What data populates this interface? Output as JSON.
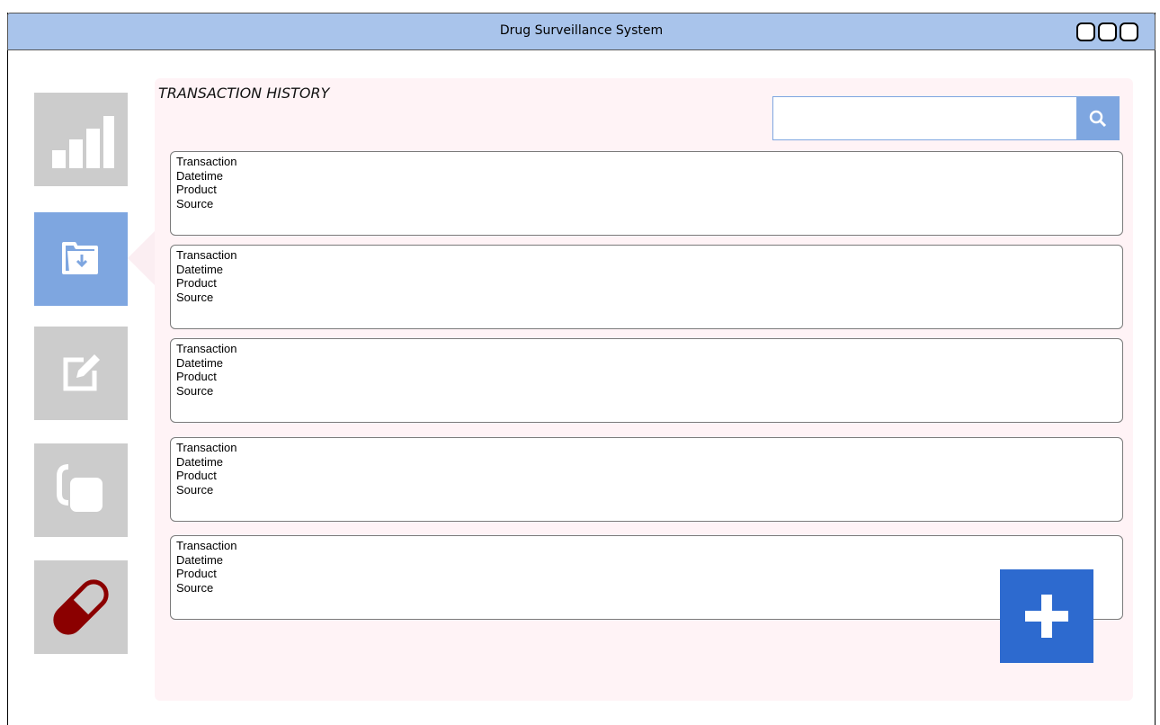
{
  "window": {
    "title": "Drug Surveillance System"
  },
  "panel": {
    "title": "TRANSACTION HISTORY"
  },
  "search": {
    "placeholder": "",
    "value": ""
  },
  "transactions": [
    {
      "transaction": "Transaction",
      "datetime": "Datetime",
      "product": "Product",
      "source": "Source"
    },
    {
      "transaction": "Transaction",
      "datetime": "Datetime",
      "product": "Product",
      "source": "Source"
    },
    {
      "transaction": "Transaction",
      "datetime": "Datetime",
      "product": "Product",
      "source": "Source"
    },
    {
      "transaction": "Transaction",
      "datetime": "Datetime",
      "product": "Product",
      "source": "Source"
    },
    {
      "transaction": "Transaction",
      "datetime": "Datetime",
      "product": "Product",
      "source": "Source"
    }
  ],
  "sidebar": {
    "items": [
      {
        "icon": "bar-chart-icon",
        "active": false
      },
      {
        "icon": "folder-download-icon",
        "active": true
      },
      {
        "icon": "edit-icon",
        "active": false
      },
      {
        "icon": "copy-icon",
        "active": false
      },
      {
        "icon": "pill-icon",
        "active": false
      }
    ]
  },
  "colors": {
    "titlebar": "#a9c4eb",
    "sidebar_inactive": "#cccccc",
    "sidebar_active": "#7ea6e0",
    "panel_bg": "#fff3f6",
    "fab": "#2d6acf",
    "pill": "#8b0000"
  }
}
